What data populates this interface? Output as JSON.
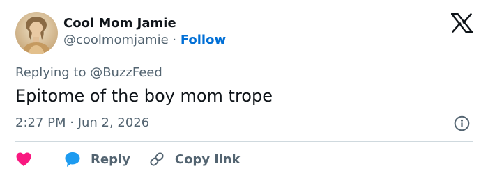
{
  "author": {
    "display_name": "Cool Mom Jamie",
    "handle": "@coolmomjamie",
    "separator": " · ",
    "follow_label": "Follow"
  },
  "platform_icon": "x-logo-icon",
  "tweet": {
    "replying_prefix": "Replying to ",
    "replying_to": "@BuzzFeed",
    "text": "Epitome of the boy mom trope",
    "timestamp": "2:27 PM · Jun 2, 2026"
  },
  "actions": {
    "like_icon": "heart-icon",
    "reply_label": "Reply",
    "reply_icon": "speech-bubble-icon",
    "copy_label": "Copy link",
    "copy_icon": "link-icon"
  },
  "colors": {
    "text": "#0f1419",
    "muted": "#536471",
    "link": "#006fd6",
    "like": "#f91880",
    "reply": "#1d9bf0",
    "divider": "#cfd9de"
  }
}
